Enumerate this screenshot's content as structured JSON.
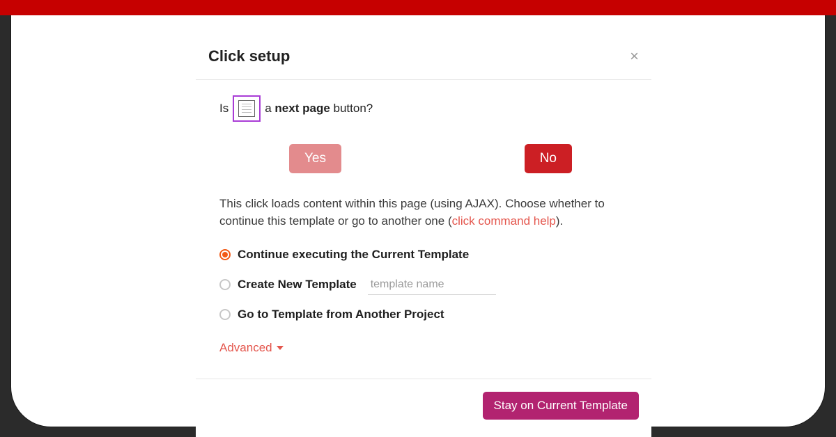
{
  "colors": {
    "stripe": "#c60000",
    "accent_link": "#e4564d",
    "radio_selected": "#f35a16",
    "primary": "#b22370",
    "btn_yes": "#e38b8d",
    "btn_no": "#cc1f24"
  },
  "modal": {
    "title": "Click setup",
    "close_glyph": "×",
    "question": {
      "prefix": "Is",
      "bold": "next page",
      "middle": " a ",
      "suffix": " button?"
    },
    "yes_label": "Yes",
    "no_label": "No",
    "explain": {
      "text_before": "This click loads content within this page (using AJAX). Choose whether to continue this template or go to another one (",
      "link_text": "click command help",
      "text_after": ")."
    },
    "radios": {
      "continue_label": "Continue executing the Current Template",
      "create_label": "Create New Template",
      "create_placeholder": "template name",
      "goto_label": "Go to Template from Another Project",
      "selected": "continue"
    },
    "advanced_label": "Advanced",
    "footer": {
      "primary_label": "Stay on Current Template"
    }
  }
}
